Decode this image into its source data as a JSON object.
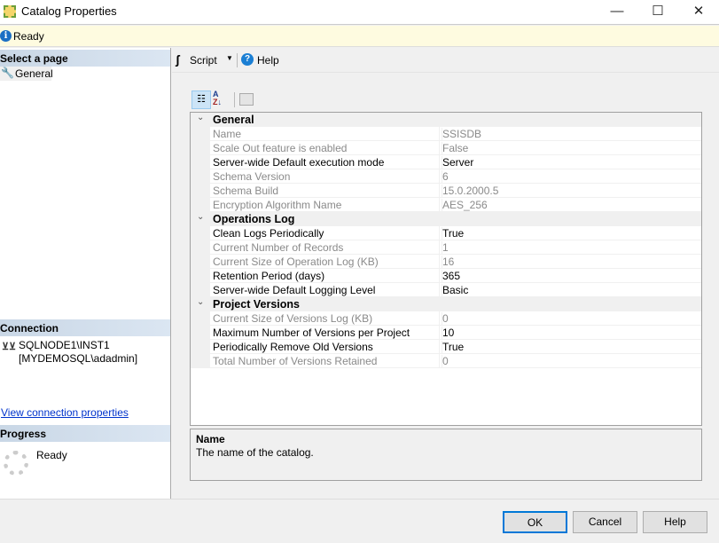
{
  "window": {
    "title": "Catalog Properties",
    "minimize": "—",
    "maximize": "☐",
    "close": "✕"
  },
  "status": {
    "text": "Ready"
  },
  "left": {
    "select_page_header": "Select a page",
    "pages": [
      {
        "label": "General"
      }
    ],
    "connection_header": "Connection",
    "server": "SQLNODE1\\INST1",
    "user": "[MYDEMOSQL\\adadmin]",
    "view_connection_link": "View connection properties",
    "progress_header": "Progress",
    "progress_status": "Ready"
  },
  "toolbar": {
    "script_label": "Script",
    "help_label": "Help"
  },
  "grid": {
    "categories": [
      {
        "name": "General",
        "rows": [
          {
            "name": "Name",
            "value": "SSISDB",
            "enabled": false
          },
          {
            "name": "Scale Out feature is enabled",
            "value": "False",
            "enabled": false
          },
          {
            "name": "Server-wide Default execution mode",
            "value": "Server",
            "enabled": true
          },
          {
            "name": "Schema Version",
            "value": "6",
            "enabled": false
          },
          {
            "name": "Schema Build",
            "value": "15.0.2000.5",
            "enabled": false
          },
          {
            "name": "Encryption Algorithm Name",
            "value": "AES_256",
            "enabled": false
          }
        ]
      },
      {
        "name": "Operations Log",
        "rows": [
          {
            "name": "Clean Logs Periodically",
            "value": "True",
            "enabled": true
          },
          {
            "name": "Current Number of Records",
            "value": "1",
            "enabled": false
          },
          {
            "name": "Current Size of Operation Log (KB)",
            "value": "16",
            "enabled": false
          },
          {
            "name": "Retention Period (days)",
            "value": "365",
            "enabled": true
          },
          {
            "name": "Server-wide Default Logging Level",
            "value": "Basic",
            "enabled": true
          }
        ]
      },
      {
        "name": "Project Versions",
        "rows": [
          {
            "name": "Current Size of Versions Log (KB)",
            "value": "0",
            "enabled": false
          },
          {
            "name": "Maximum Number of Versions per Project",
            "value": "10",
            "enabled": true
          },
          {
            "name": "Periodically Remove Old Versions",
            "value": "True",
            "enabled": true
          },
          {
            "name": "Total Number of Versions Retained",
            "value": "0",
            "enabled": false
          }
        ]
      }
    ]
  },
  "description": {
    "title": "Name",
    "text": "The name of the catalog."
  },
  "buttons": {
    "ok": "OK",
    "cancel": "Cancel",
    "help": "Help"
  }
}
